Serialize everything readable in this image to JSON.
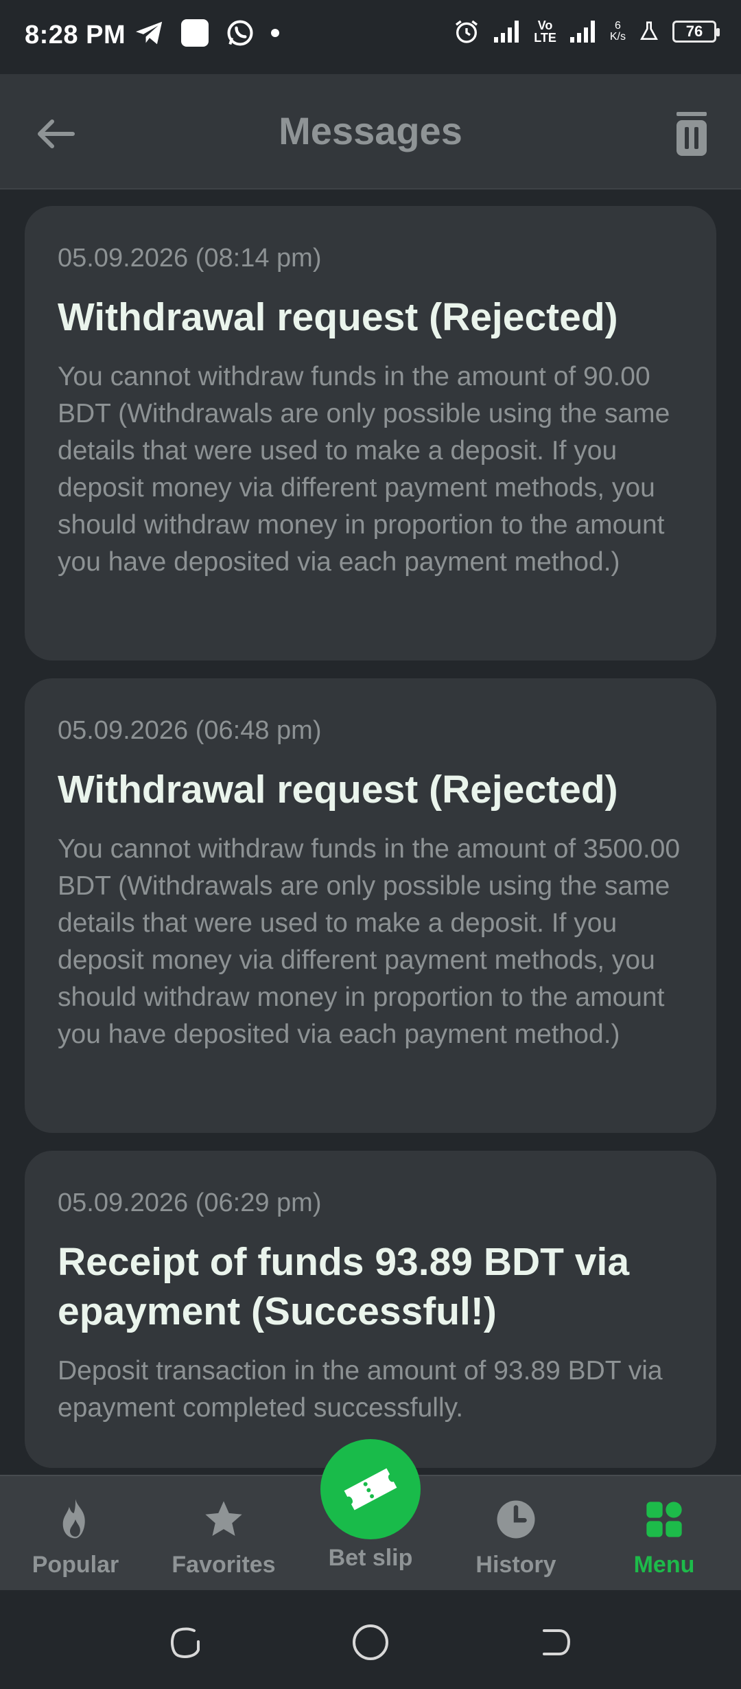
{
  "status_bar": {
    "time": "8:28 PM",
    "battery": "76",
    "net_speed_value": "6",
    "net_speed_unit": "K/s",
    "lte_top": "Vo",
    "lte_bottom": "LTE"
  },
  "header": {
    "title": "Messages"
  },
  "messages": [
    {
      "date": "05.09.2026 (08:14 pm)",
      "title": "Withdrawal request (Rejected)",
      "body": "You cannot withdraw funds in the amount of 90.00 BDT (Withdrawals are only possible using the same details that were used to make a deposit. If you deposit money via different payment methods, you should withdraw money in proportion to the amount you have deposited via each payment method.)"
    },
    {
      "date": "05.09.2026 (06:48 pm)",
      "title": "Withdrawal request (Rejected)",
      "body": "You cannot withdraw funds in the amount of 3500.00 BDT (Withdrawals are only possible using the same details that were used to make a deposit. If you deposit money via different payment methods, you should withdraw money in proportion to the amount you have deposited via each payment method.)"
    },
    {
      "date": "05.09.2026 (06:29 pm)",
      "title": "Receipt of funds 93.89 BDT via epayment (Successful!)",
      "body": "Deposit transaction in the amount of 93.89 BDT via epayment completed successfully."
    }
  ],
  "bottom_nav": {
    "items": [
      {
        "label": "Popular",
        "icon": "flame-icon"
      },
      {
        "label": "Favorites",
        "icon": "star-icon"
      },
      {
        "label": "Bet slip",
        "icon": "ticket-icon"
      },
      {
        "label": "History",
        "icon": "clock-icon"
      },
      {
        "label": "Menu",
        "icon": "grid-icon",
        "active": true
      }
    ]
  },
  "colors": {
    "accent": "#1dbb4a",
    "background": "#23272b",
    "card": "#33373b",
    "muted_text": "#8d9294"
  }
}
